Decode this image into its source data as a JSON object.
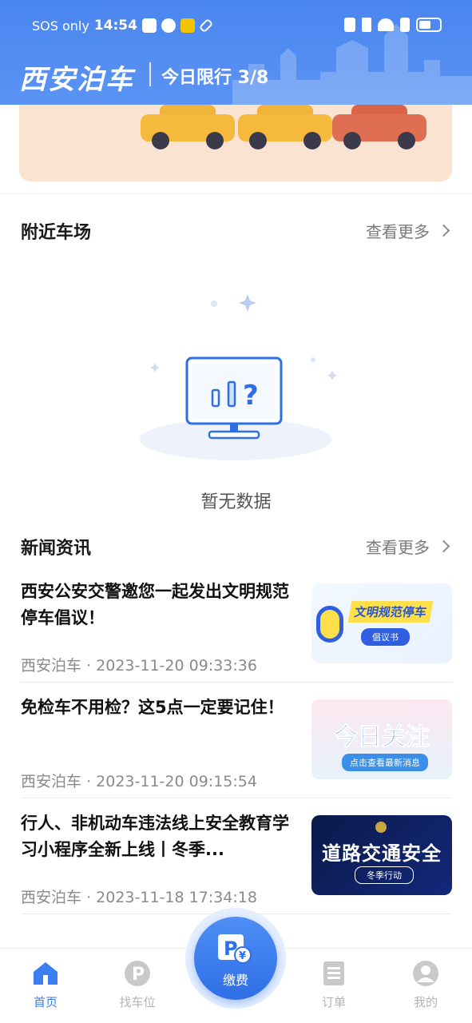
{
  "status_bar": {
    "carrier": "SOS only",
    "time": "14:54"
  },
  "header": {
    "brand": "西安泊车",
    "restriction": "今日限行 3/8"
  },
  "nearby": {
    "title": "附近车场",
    "more": "查看更多",
    "empty_text": "暂无数据"
  },
  "news": {
    "title": "新闻资讯",
    "more": "查看更多",
    "items": [
      {
        "title": "西安公安交警邀您一起发出文明规范停车倡议！",
        "source": "西安泊车",
        "sep": "·",
        "time": "2023-11-20 09:33:36",
        "thumb_title": "文明规范停车",
        "thumb_sub": "倡议书"
      },
      {
        "title": "免检车不用检？这5点一定要记住！",
        "source": "西安泊车",
        "sep": "·",
        "time": "2023-11-20 09:15:54",
        "thumb_title": "今日关注",
        "thumb_sub": "点击查看最新消息"
      },
      {
        "title": "行人、非机动车违法线上安全教育学习小程序全新上线丨冬季...",
        "source": "西安泊车",
        "sep": "·",
        "time": "2023-11-18 17:34:18",
        "thumb_title": "道路交通安全",
        "thumb_sub": "冬季行动"
      }
    ]
  },
  "bottom_nav": {
    "home": "首页",
    "find_parking": "找车位",
    "pay": "缴费",
    "orders": "订单",
    "mine": "我的"
  },
  "colors": {
    "primary": "#3a7ef0",
    "header_bg": "#4a86f0",
    "inactive": "#b3b3b3"
  }
}
